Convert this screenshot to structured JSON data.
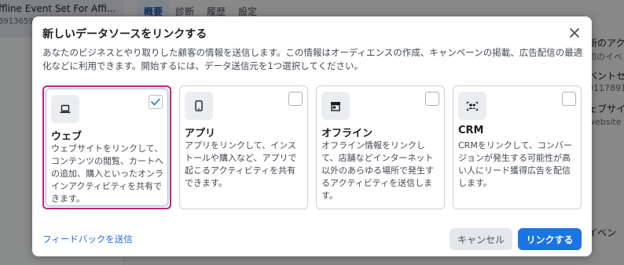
{
  "background": {
    "left_panel": {
      "title": "ffline Event Set For Affi...",
      "subtitle": "39136596"
    },
    "tabs": [
      {
        "label": "概要"
      },
      {
        "label": "診断"
      },
      {
        "label": "履歴"
      },
      {
        "label": "設定"
      }
    ],
    "right_panel": {
      "line1": "新のアク",
      "line2": "初のイベ",
      "line3": "ベントセ",
      "line4": "01178914",
      "line5": "ェブサイ",
      "line6": "website",
      "line7": "イベン"
    }
  },
  "modal": {
    "title": "新しいデータソースをリンクする",
    "close_icon": "close-icon",
    "description": "あなたのビジネスとやり取りした顧客の情報を送信します。この情報はオーディエンスの作成、キャンペーンの掲載、広告配信の最適化などに利用できます。開始するには、データ送信元を1つ選択してください。",
    "options": [
      {
        "name": "ウェブ",
        "icon": "laptop-icon",
        "selected": true,
        "description": "ウェブサイトをリンクして、コンテンツの閲覧、カートへの追加、購入といったオンラインアクティビティを共有できます。"
      },
      {
        "name": "アプリ",
        "icon": "phone-icon",
        "selected": false,
        "description": "アプリをリンクして、インストールや購入など、アプリで起こるアクティビティを共有できます。"
      },
      {
        "name": "オフライン",
        "icon": "store-icon",
        "selected": false,
        "description": "オフライン情報をリンクして、店舗などインターネット以外のあらゆる場所で発生するアクティビティを送信します。"
      },
      {
        "name": "CRM",
        "icon": "people-icon",
        "selected": false,
        "description": "CRMをリンクして、コンバージョンが発生する可能性が高い人にリード獲得広告を配信します。"
      }
    ],
    "feedback_link": "フィードバックを送信",
    "cancel_label": "キャンセル",
    "link_label": "リンクする"
  },
  "colors": {
    "primary": "#1b74e4",
    "selected_outline": "#c3237a",
    "link": "#216fdb"
  }
}
